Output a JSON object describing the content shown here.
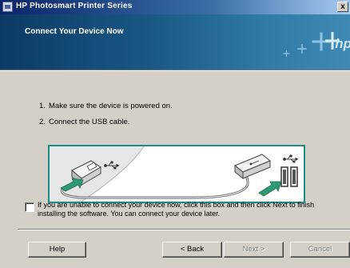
{
  "window": {
    "title": "HP Photosmart Printer Series",
    "close_glyph": "x"
  },
  "header": {
    "title": "Connect Your Device Now",
    "logo_text": "hp"
  },
  "steps": [
    {
      "number": "1.",
      "text": "Make sure the device is powered on."
    },
    {
      "number": "2.",
      "text": "Connect the USB cable."
    }
  ],
  "checkbox": {
    "checked": false,
    "label": "If you are unable to connect your device now, click this box and then click Next to finish installing the software. You can connect your device later."
  },
  "buttons": {
    "help": "Help",
    "back": "< Back",
    "next": "Next >",
    "cancel": "Cancel"
  },
  "colors": {
    "header_dark": "#0c3a64",
    "header_light": "#3f8ab4",
    "illustration_border": "#1a8d86",
    "arrow_green": "#2f9a72"
  },
  "icons": [
    "usb-icon",
    "usb-icon"
  ]
}
